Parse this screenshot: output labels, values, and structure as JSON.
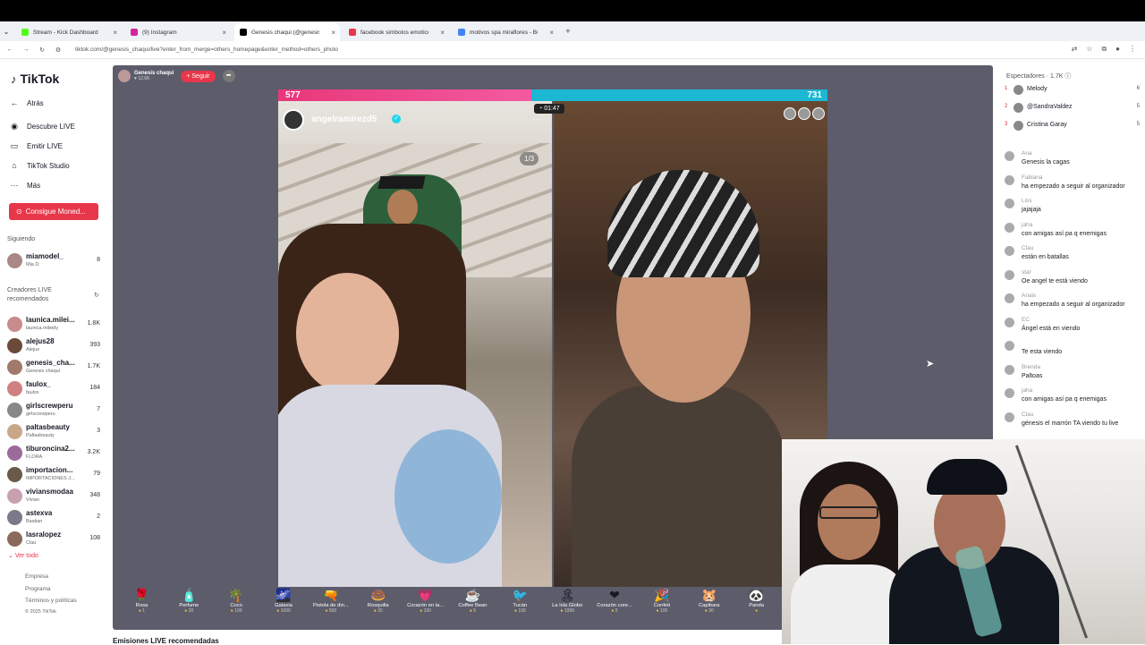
{
  "browser": {
    "tabs": [
      {
        "title": "Stream - Kick Dashboard",
        "color": "#53fc18"
      },
      {
        "title": "(9) Instagram",
        "color": "#d6249f"
      },
      {
        "title": "Genesis chaqui (@genesis...",
        "color": "#000000"
      },
      {
        "title": "facebook simbolos emoticon...",
        "color": "#e8374a"
      },
      {
        "title": "motivos spa miraflores - Busca...",
        "color": "#4285f4"
      }
    ],
    "url": "tiktok.com/@genesis_chaqui/live?enter_from_merge=others_homepage&enter_method=others_photo"
  },
  "sidebar": {
    "brand": "TikTok",
    "back": "Atrás",
    "nav": [
      "Descubre LIVE",
      "Emitir LIVE",
      "TikTok Studio",
      "Más"
    ],
    "coins_button": "Consigue Moned...",
    "following_title": "Siguiendo",
    "following": [
      {
        "name": "miamodel_",
        "sub": "Mia D.",
        "count": "8"
      }
    ],
    "recommended_title": "Creadores LIVE recomendados",
    "recommended": [
      {
        "name": "launica.milei...",
        "sub": "launica.mileidy",
        "count": "1.8K"
      },
      {
        "name": "alejus28",
        "sub": "Alejus",
        "count": "393"
      },
      {
        "name": "genesis_cha...",
        "sub": "Genesis chaqui",
        "count": "1.7K"
      },
      {
        "name": "faulox_",
        "sub": "faulox",
        "count": "184"
      },
      {
        "name": "girlscrewperu",
        "sub": "girlscrewperu",
        "count": "7"
      },
      {
        "name": "paltasbeauty",
        "sub": "Paltasbeauty",
        "count": "3"
      },
      {
        "name": "tiburoncina2...",
        "sub": "FLORA",
        "count": "3.2K"
      },
      {
        "name": "importacion...",
        "sub": "IMPORTACIONES J...",
        "count": "79"
      },
      {
        "name": "viviansmodaa",
        "sub": "Vivian",
        "count": "348"
      },
      {
        "name": "astexva",
        "sub": "Bastian",
        "count": "2"
      },
      {
        "name": "lasralopez",
        "sub": "Clau",
        "count": "108"
      }
    ],
    "see_all": "Ver todo",
    "footer": [
      "Empresa",
      "Programa",
      "Términos y políticas",
      "© 2025 TikTok"
    ]
  },
  "live": {
    "host_name": "Genesis chaqui",
    "host_viewers": "12.6K",
    "follow_label": "+ Seguir",
    "score_left": "577",
    "score_right": "731",
    "timer": "01:47",
    "battle_name": "angelramirezd5",
    "page_indicator": "1/3"
  },
  "gifts": [
    {
      "name": "Rosa",
      "price": "1",
      "icon": "rose-icon",
      "glyph": "🌹"
    },
    {
      "name": "Perfume",
      "price": "20",
      "icon": "perfume-icon",
      "glyph": "🧴"
    },
    {
      "name": "Coco",
      "price": "199",
      "icon": "palm-icon",
      "glyph": "🌴"
    },
    {
      "name": "Galaxia",
      "price": "1000",
      "icon": "galaxy-icon",
      "glyph": "🌌"
    },
    {
      "name": "Pistola de din...",
      "price": "500",
      "icon": "money-gun-icon",
      "glyph": "🔫"
    },
    {
      "name": "Rosquilla",
      "price": "30",
      "icon": "donut-icon",
      "glyph": "🍩"
    },
    {
      "name": "Corazón en la...",
      "price": "100",
      "icon": "heart-icon",
      "glyph": "💗"
    },
    {
      "name": "Coffee Bean",
      "price": "5",
      "icon": "coffee-icon",
      "glyph": "☕"
    },
    {
      "name": "Tucán",
      "price": "199",
      "icon": "toucan-icon",
      "glyph": "🐦"
    },
    {
      "name": "La Isla Globo",
      "price": "1999",
      "icon": "island-icon",
      "glyph": "🏝"
    },
    {
      "name": "Corazón core...",
      "price": "5",
      "icon": "heart-core-icon",
      "glyph": "❤"
    },
    {
      "name": "Confeti",
      "price": "100",
      "icon": "confetti-icon",
      "glyph": "🎉"
    },
    {
      "name": "Capibara",
      "price": "30",
      "icon": "capybara-icon",
      "glyph": "🐹"
    },
    {
      "name": "Panda",
      "price": "",
      "icon": "panda-icon",
      "glyph": "🐼"
    }
  ],
  "below_title": "Emisiones LIVE recomendadas",
  "viewers": {
    "title": "Espectadores · 1.7K",
    "list": [
      {
        "rank": "1",
        "name": "Melody",
        "count": "6"
      },
      {
        "rank": "2",
        "name": "@SandraValdez",
        "count": "5"
      },
      {
        "rank": "3",
        "name": "Cristina Garay",
        "count": "5"
      }
    ]
  },
  "chat": [
    {
      "user": "Ana",
      "text": "Genesis la cagas"
    },
    {
      "user": "Fabiana",
      "text": "ha empezado a seguir al organizador"
    },
    {
      "user": "Liss",
      "text": "jajajaja"
    },
    {
      "user": "jaha",
      "text": "con amigas así pa q enemigas"
    },
    {
      "user": "Clau",
      "text": "están en batallas"
    },
    {
      "user": "star",
      "text": "Oe angel te está viendo"
    },
    {
      "user": "Anais",
      "text": "ha empezado a seguir al organizador"
    },
    {
      "user": "EC",
      "text": "Ángel está en viendo"
    },
    {
      "user": "",
      "text": "Te esta viendo"
    },
    {
      "user": "Brenda",
      "text": "Paltoas"
    },
    {
      "user": "jaha",
      "text": "con amigas así pa q enemigas"
    },
    {
      "user": "Clau",
      "text": "génesis el marrón TA viendo tu live"
    }
  ]
}
